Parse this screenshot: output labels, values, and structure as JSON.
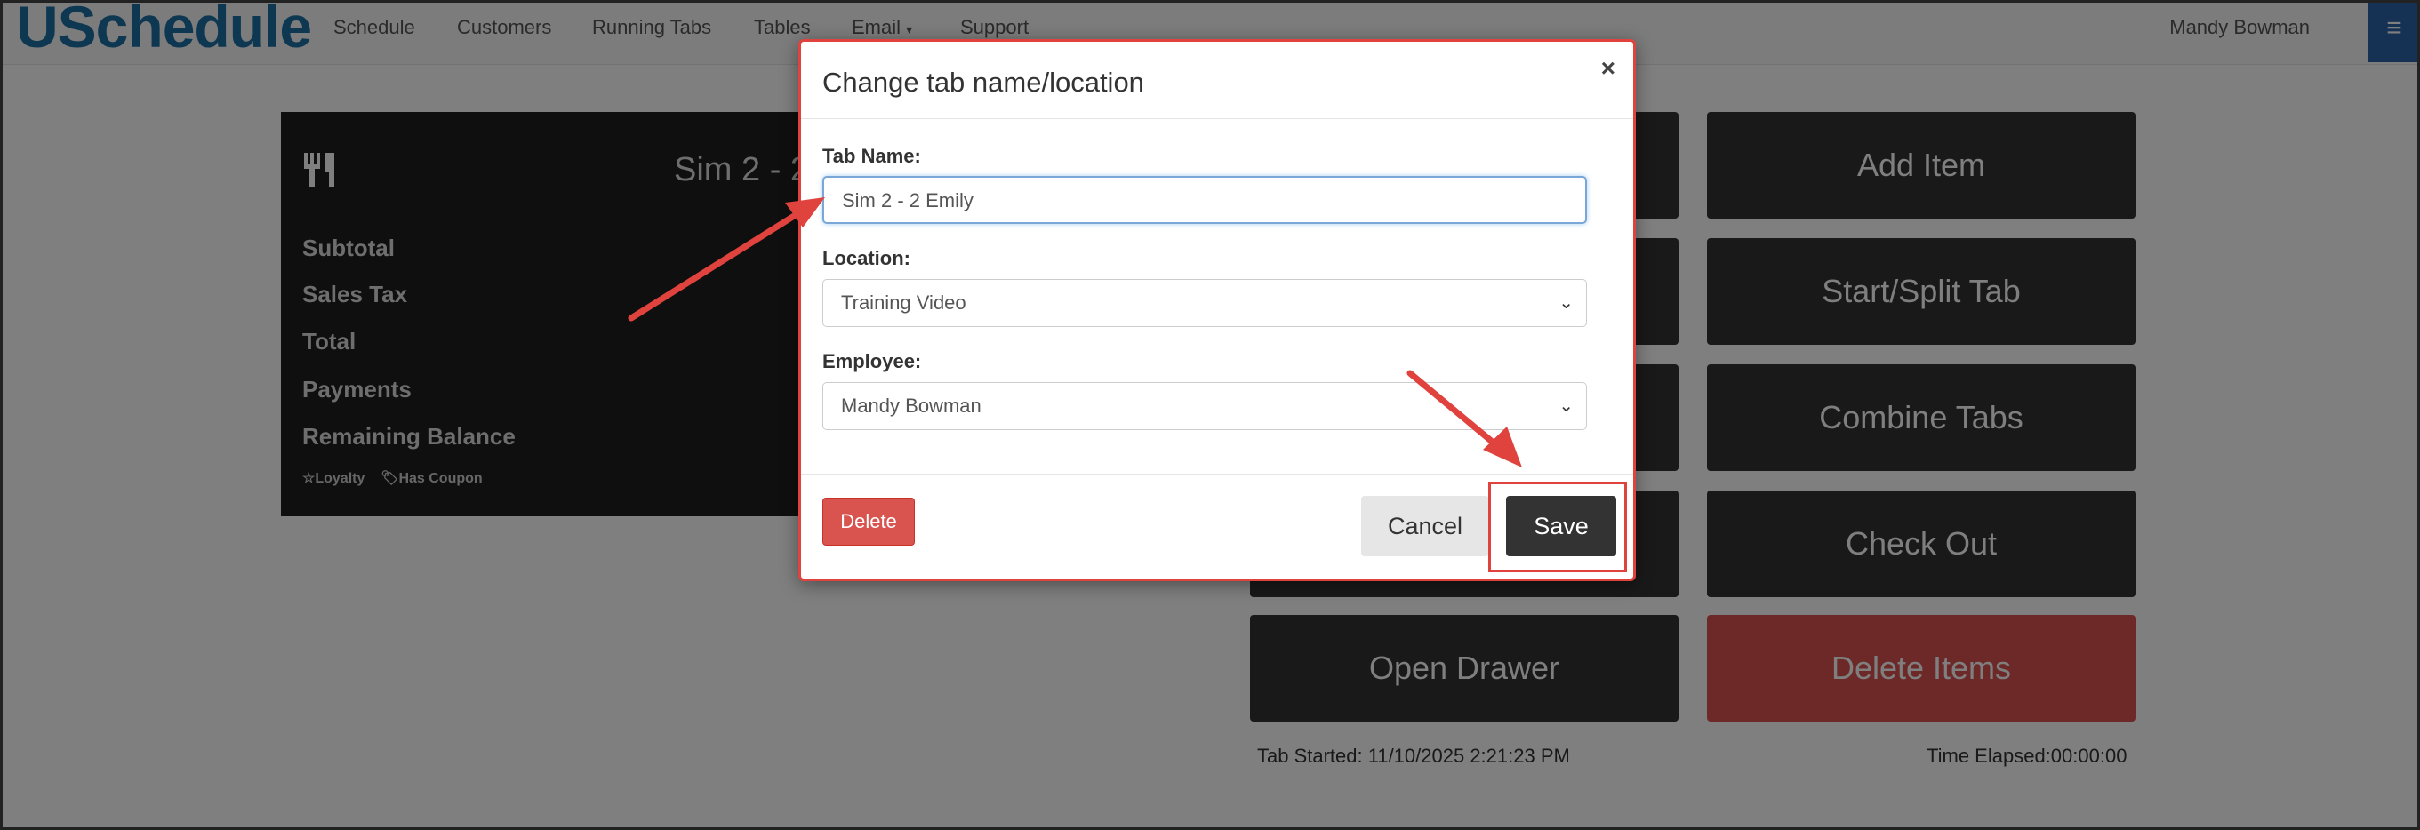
{
  "app": {
    "brand": "USchedule"
  },
  "nav": {
    "items": [
      "Schedule",
      "Customers",
      "Running Tabs",
      "Tables",
      "Email",
      "Support"
    ],
    "email_caret": "▾",
    "user_name": "Mandy Bowman",
    "menu_icon": "≡"
  },
  "tab_panel": {
    "title": "Sim 2 - 2 Emily",
    "labels": [
      "Subtotal",
      "Sales Tax",
      "Total",
      "Payments",
      "Remaining Balance"
    ],
    "badges": {
      "loyalty": "☆Loyalty",
      "coupon": "Has Coupon"
    }
  },
  "actions": {
    "left": [
      "",
      "",
      "",
      "",
      "Open Drawer"
    ],
    "right": [
      "Add Item",
      "Start/Split Tab",
      "Combine Tabs",
      "Check Out",
      "Delete Items"
    ]
  },
  "footer": {
    "tab_started": "Tab Started: 11/10/2025 2:21:23 PM",
    "time_elapsed": "Time Elapsed:00:00:00"
  },
  "modal": {
    "title": "Change tab name/location",
    "close": "×",
    "tab_name_label": "Tab Name:",
    "tab_name_value": "Sim 2 - 2 Emily",
    "location_label": "Location:",
    "location_value": "Training Video",
    "employee_label": "Employee:",
    "employee_value": "Mandy Bowman",
    "delete_label": "Delete",
    "cancel_label": "Cancel",
    "save_label": "Save"
  },
  "colors": {
    "brand": "#1d6fa3",
    "danger": "#d9534f",
    "dark_button": "#333333",
    "annotation": "#e0433d"
  }
}
